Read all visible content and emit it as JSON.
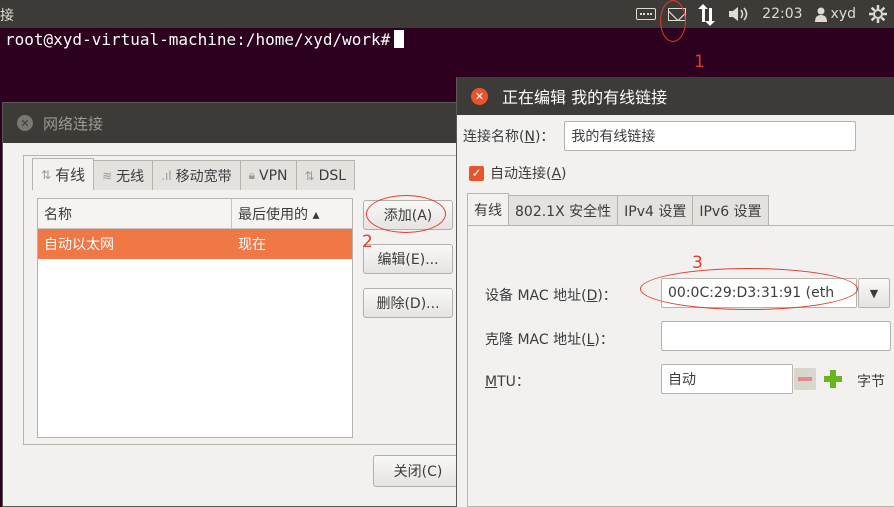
{
  "top_panel": {
    "window_title": "接",
    "time": "22:03",
    "user": "xyd",
    "icons": [
      "keyboard-icon",
      "mail-icon",
      "network-icon",
      "volume-icon",
      "gear-icon"
    ]
  },
  "terminal": {
    "prompt": "root@xyd-virtual-machine:/home/xyd/work#"
  },
  "network_connections": {
    "title": "网络连接",
    "tabs": [
      {
        "label": "有线",
        "icon": "wired-icon",
        "active": true
      },
      {
        "label": "无线",
        "icon": "wifi-icon"
      },
      {
        "label": "移动宽带",
        "icon": "signal-icon"
      },
      {
        "label": "VPN",
        "icon": "lock-icon"
      },
      {
        "label": "DSL",
        "icon": "dsl-icon"
      }
    ],
    "columns": {
      "name": "名称",
      "last_used": "最后使用的 ▴"
    },
    "rows": [
      {
        "name": "自动以太网",
        "last_used": "现在",
        "selected": true
      }
    ],
    "buttons": {
      "add": "添加(A)",
      "edit": "编辑(E)...",
      "delete": "删除(D)...",
      "close": "关闭(C)"
    }
  },
  "edit_dialog": {
    "title": "正在编辑 我的有线链接",
    "connection_name_label": "连接名称(N)：",
    "connection_name_value": "我的有线链接",
    "auto_connect_label": "自动连接(A)",
    "auto_connect_checked": true,
    "tabs": [
      "有线",
      "802.1X 安全性",
      "IPv4 设置",
      "IPv6 设置"
    ],
    "device_mac_label": "设备 MAC 地址(D)：",
    "device_mac_value": "00:0C:29:D3:31:91 (eth",
    "clone_mac_label": "克隆 MAC 地址(L)：",
    "clone_mac_value": "",
    "mtu_label": "MTU：",
    "mtu_value": "自动",
    "mtu_unit": "字节"
  },
  "annotations": {
    "n1": "1",
    "n2": "2",
    "n3": "3"
  },
  "colors": {
    "accent": "#f07746",
    "annotation": "#e43b2c",
    "panel": "#3c3b37",
    "desktop": "#2c001e"
  }
}
